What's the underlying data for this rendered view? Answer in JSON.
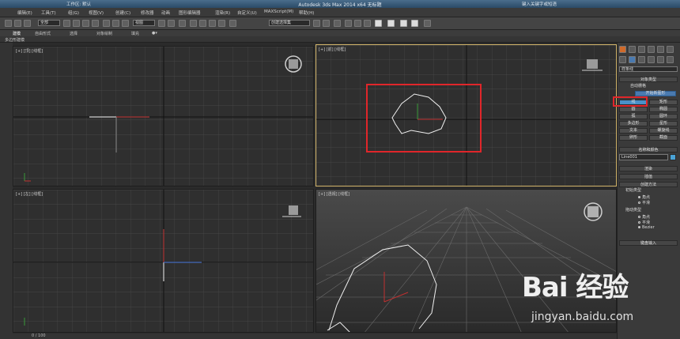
{
  "window": {
    "title": "Autodesk 3ds Max 2014 x64    无标题",
    "workspace": "工作区: 默认",
    "search_placeholder": "键入关键字或短语"
  },
  "menu": [
    "编辑(E)",
    "工具(T)",
    "组(G)",
    "视图(V)",
    "创建(C)",
    "修改器",
    "动画",
    "图形编辑器",
    "渲染(R)",
    "自定义(U)",
    "MAXScript(M)",
    "帮助(H)"
  ],
  "toolbar": {
    "selection_filter": "全部",
    "coord_system": "视图",
    "named_selection": "创建选择集"
  },
  "ribbon": {
    "tabs": [
      "建模",
      "自由形式",
      "选择",
      "对象绘制",
      "填充"
    ],
    "subtitle": "多边形建模"
  },
  "viewports": {
    "top_label": "[+] [顶] [线框]",
    "front_label": "[+] [前] [线框]",
    "left_label": "[+] [左] [线框]",
    "persp_label": "[+] [透视] [线框]"
  },
  "command_panel": {
    "category": "样条线",
    "object_type_header": "对象类型",
    "auto_grid": "自动栅格",
    "start_new_shape": "开始新图形",
    "shapes": [
      "线",
      "矩形",
      "圆",
      "椭圆",
      "弧",
      "圆环",
      "多边形",
      "星形",
      "文本",
      "螺旋线",
      "卵形",
      "截面"
    ],
    "name_color_header": "名称和颜色",
    "object_name": "Line001",
    "rendering_header": "渲染",
    "interpolation_header": "插值",
    "creation_method_header": "创建方法",
    "initial_type_label": "初始类型",
    "initial_options": [
      "角点",
      "平滑"
    ],
    "drag_type_label": "拖动类型",
    "drag_options": [
      "角点",
      "平滑",
      "Bezier"
    ],
    "keyboard_entry_header": "键盘输入",
    "accent_color": "#4aa3d6"
  },
  "status": {
    "frame": "0 / 100"
  },
  "watermark": {
    "logo": "Bai 经验",
    "url": "jingyan.baidu.com"
  }
}
